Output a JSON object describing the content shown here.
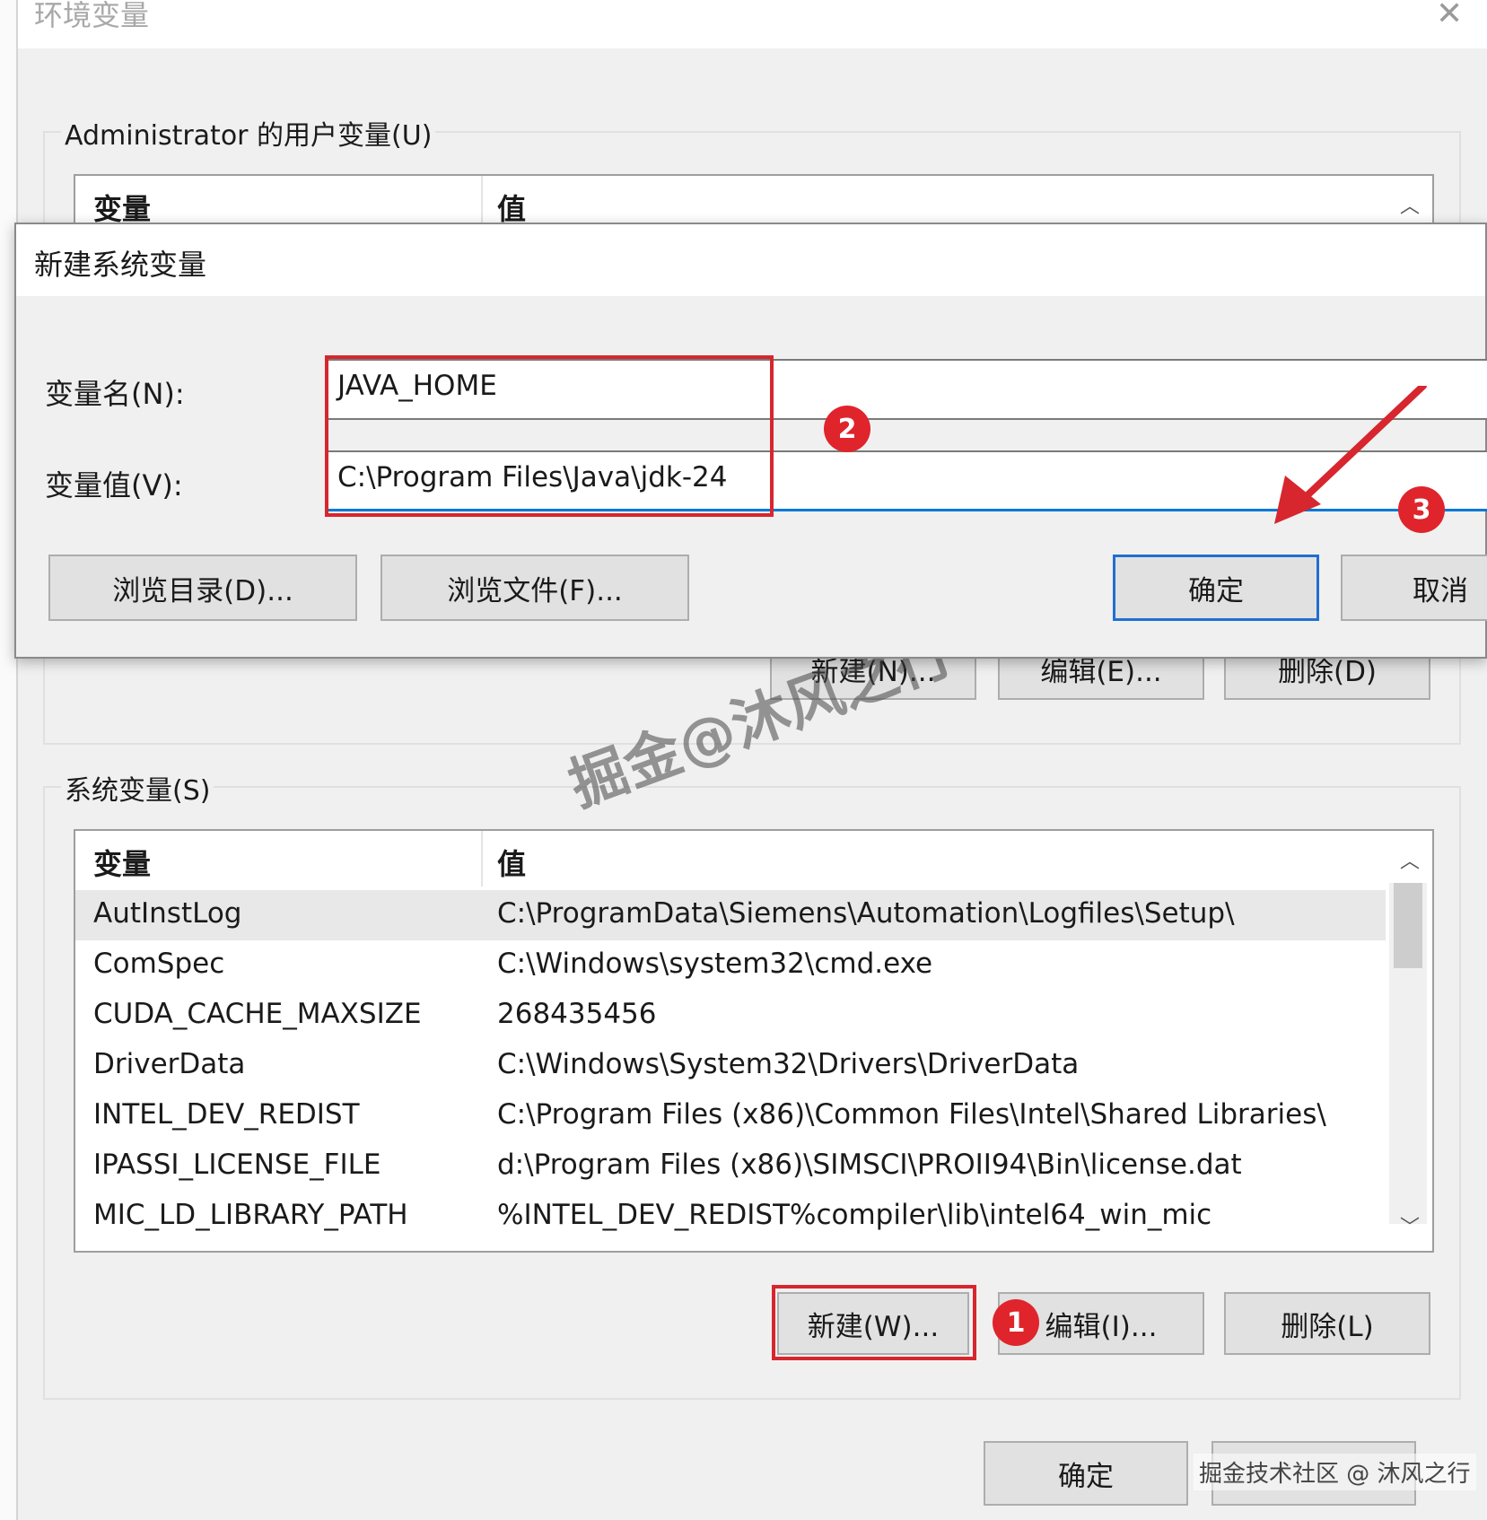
{
  "window": {
    "title": "环境变量",
    "close_icon": "close-icon"
  },
  "user_vars": {
    "label": "Administrator 的用户变量(U)",
    "headers": [
      "变量",
      "值"
    ],
    "buttons": {
      "new": "新建(N)...",
      "edit": "编辑(E)...",
      "delete": "删除(D)"
    }
  },
  "dialog": {
    "title": "新建系统变量",
    "name_label": "变量名(N):",
    "name_value": "JAVA_HOME",
    "value_label": "变量值(V):",
    "value_value": "C:\\Program Files\\Java\\jdk-24",
    "browse_dir": "浏览目录(D)...",
    "browse_file": "浏览文件(F)...",
    "ok": "确定",
    "cancel": "取消"
  },
  "system_vars": {
    "label": "系统变量(S)",
    "headers": [
      "变量",
      "值"
    ],
    "rows": [
      {
        "name": "AutInstLog",
        "value": "C:\\ProgramData\\Siemens\\Automation\\Logfiles\\Setup\\"
      },
      {
        "name": "ComSpec",
        "value": "C:\\Windows\\system32\\cmd.exe"
      },
      {
        "name": "CUDA_CACHE_MAXSIZE",
        "value": "268435456"
      },
      {
        "name": "DriverData",
        "value": "C:\\Windows\\System32\\Drivers\\DriverData"
      },
      {
        "name": "INTEL_DEV_REDIST",
        "value": "C:\\Program Files (x86)\\Common Files\\Intel\\Shared Libraries\\"
      },
      {
        "name": "IPASSI_LICENSE_FILE",
        "value": "d:\\Program Files (x86)\\SIMSCI\\PROII94\\Bin\\license.dat"
      },
      {
        "name": "MIC_LD_LIBRARY_PATH",
        "value": "%INTEL_DEV_REDIST%compiler\\lib\\intel64_win_mic"
      }
    ],
    "buttons": {
      "new": "新建(W)...",
      "edit": "编辑(I)...",
      "delete": "删除(L)"
    }
  },
  "footer": {
    "ok": "确定"
  },
  "annotations": {
    "step1": "1",
    "step2": "2",
    "step3": "3",
    "accent": "#d7262e"
  },
  "watermark": "掘金@沐风之行",
  "corner_watermark": "掘金技术社区 @ 沐风之行"
}
